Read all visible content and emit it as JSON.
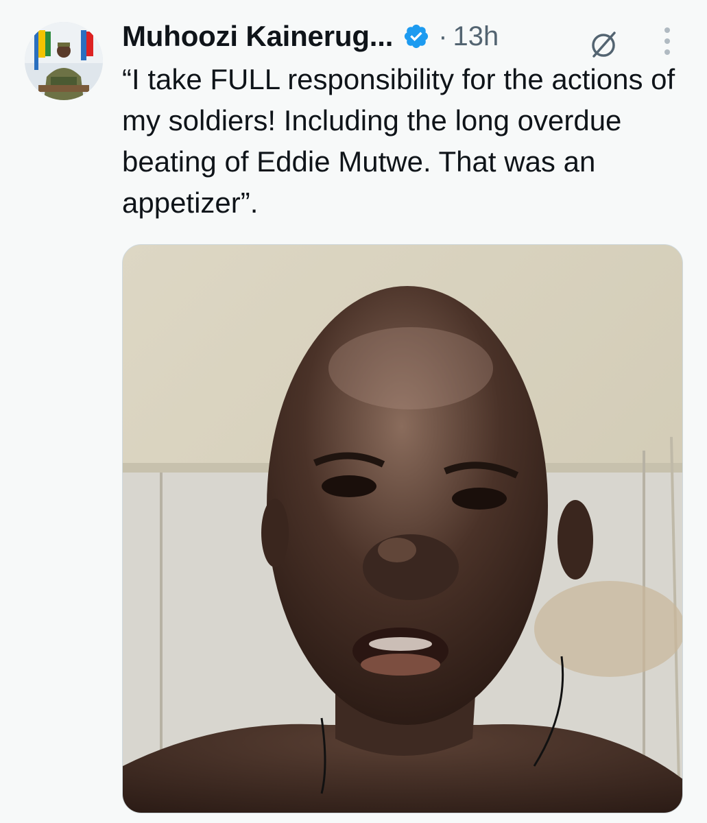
{
  "author": {
    "display_name": "Muhoozi Kainerug...",
    "verified_icon": "verified-badge-icon",
    "separator": "·",
    "timestamp": "13h"
  },
  "actions": {
    "grok_icon": "grok-slash-icon",
    "more_icon": "more-vertical-icon"
  },
  "tweet": {
    "text": "“I take FULL responsibility for the actions of my soldiers! Including the long overdue beating of Eddie Mutwe. That was an appetizer”."
  },
  "media": {
    "type": "photo"
  },
  "colors": {
    "verified_blue": "#1d9bf0",
    "secondary_text": "#536471",
    "primary_text": "#0f1419",
    "background": "#f7f9f9"
  }
}
